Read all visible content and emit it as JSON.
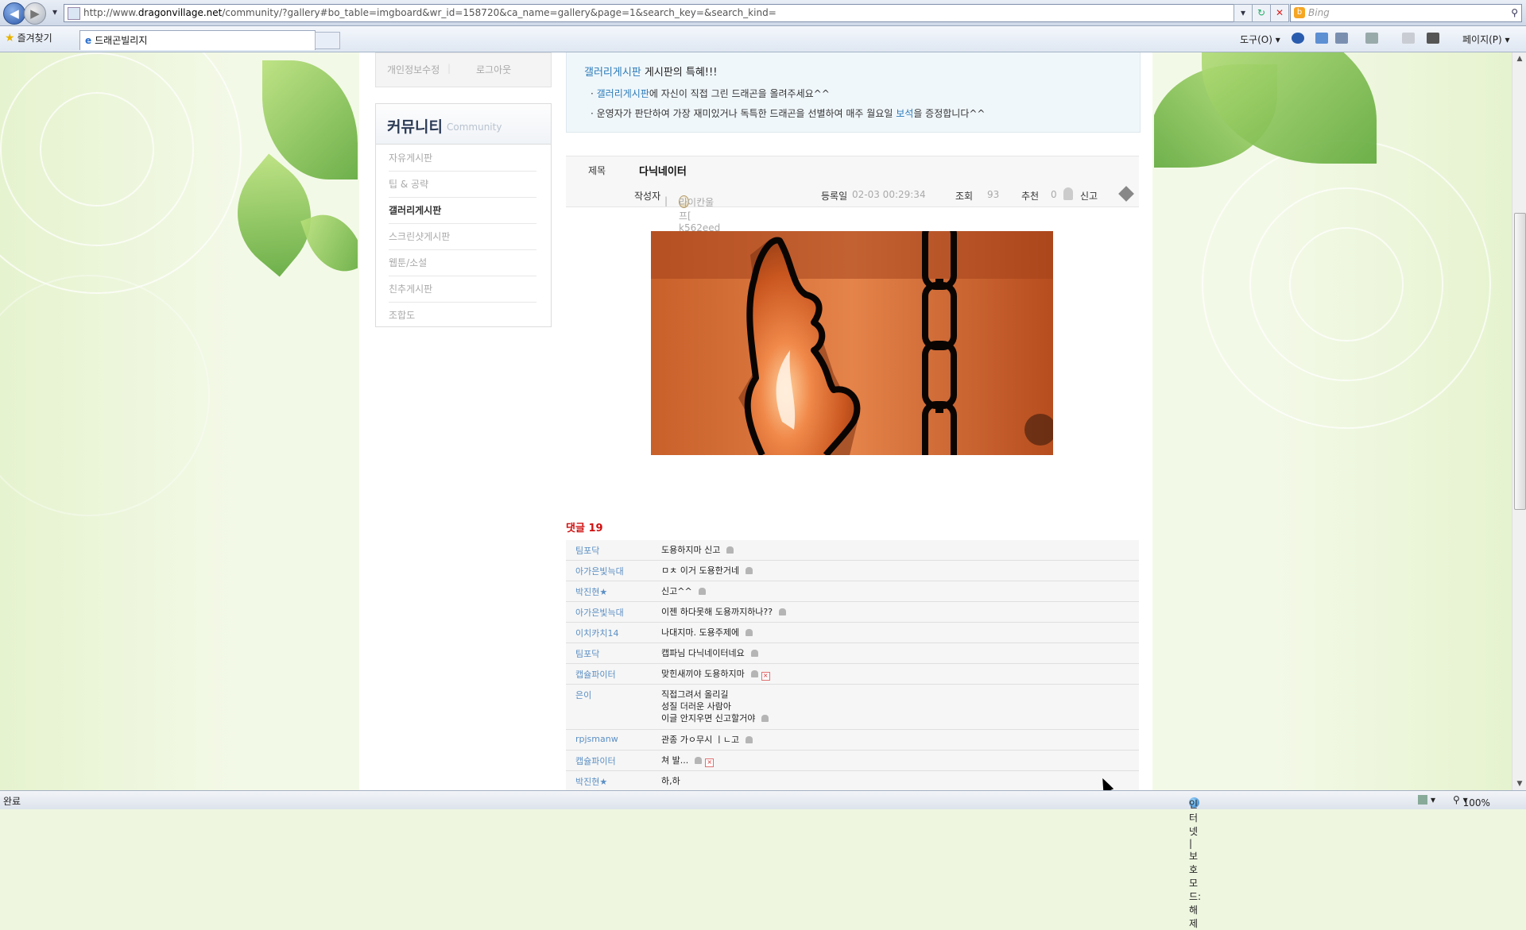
{
  "browser": {
    "url_pre": "http://www.",
    "url_domain": "dragonvillage.net",
    "url_post": "/community/?gallery#bo_table=imgboard&wr_id=158720&ca_name=gallery&page=1&search_key=&search_kind=",
    "search_placeholder": "Bing",
    "favorites_label": "즐겨찾기",
    "tab_title": "드래곤빌리지",
    "menu_tools": "도구(O)",
    "menu_page": "페이지(P)"
  },
  "sidebar": {
    "top_links": [
      "개인정보수정",
      "로그아웃"
    ],
    "heading_ko": "커뮤니티",
    "heading_en": "Community",
    "items": [
      "자유게시판",
      "팁 & 공략",
      "갤러리게시판",
      "스크린샷게시판",
      "웹툰/소설",
      "친추게시판",
      "조합도"
    ]
  },
  "notice": {
    "title_link": "갤러리게시판",
    "title_rest": " 게시판의 특혜!!!",
    "line1_link": "갤러리게시판",
    "line1_rest": "에 자신이 직접 그린 드래곤을 올려주세요^^",
    "line2_pre": "운영자가 판단하여 가장 재미있거나 독특한 드래곤을 선별하여 매주 월요일 ",
    "line2_link": "보석",
    "line2_post": "을 증정합니다^^"
  },
  "post": {
    "title_label": "제목",
    "title": "다닉네이터",
    "author_label": "작성자",
    "author": "라이칸울프[ k562eed ]",
    "date_label": "등록일",
    "date": "02-03 00:29:34",
    "views_label": "조회",
    "views": "93",
    "recommend_label": "추천",
    "recommend": "0",
    "report_label": "신고"
  },
  "comments": {
    "count_label": "댓글",
    "count": "19",
    "items": [
      {
        "author": "팀포닥",
        "text": "도용하지마 신고"
      },
      {
        "author": "아가은빛늑대",
        "text": "ㅁㅊ 이거 도용한거네"
      },
      {
        "author": "박진현★",
        "text": "신고^^"
      },
      {
        "author": "아가은빛늑대",
        "text": "이젠 하다못해 도용까지하나??"
      },
      {
        "author": "이치카치14",
        "text": "나대지마. 도용주제에"
      },
      {
        "author": "팀포닥",
        "text": "캡파님 다닉네이터네요"
      },
      {
        "author": "캡슐파이터",
        "text": "맞힌새끼야 도용하지마"
      },
      {
        "author": "은이",
        "text": "직접그려서 올리길\n성질 더러운 사람아\n이글 안지우면 신고할거야"
      },
      {
        "author": "rpjsmanw",
        "text": "관종 가ㅇ무시 ㅣㄴ고"
      },
      {
        "author": "캡슐파이터",
        "text": "쳐 발..."
      },
      {
        "author": "박진현★",
        "text": "하,하"
      }
    ]
  },
  "status": {
    "left": "완료",
    "zone": "인터넷 | 보호 모드: 해제",
    "zoom": "100%"
  },
  "colors": {
    "link_blue": "#2a7ab8",
    "comment_red": "#d01010",
    "author_blue": "#5b8fc4"
  }
}
